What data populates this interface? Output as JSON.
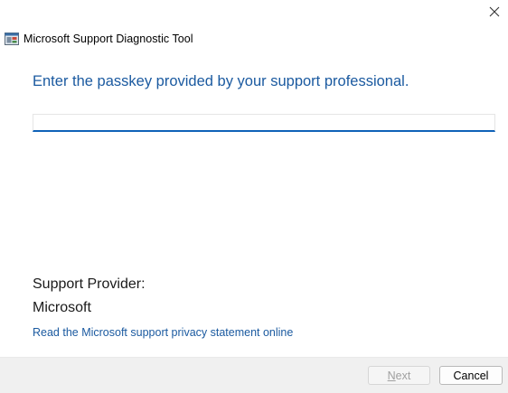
{
  "window": {
    "title": "Microsoft Support Diagnostic Tool",
    "close_icon": "close-icon",
    "app_icon": "diagnostic-tool-icon"
  },
  "main": {
    "heading": "Enter the passkey provided by your support professional.",
    "passkey_input": {
      "value": "",
      "placeholder": ""
    },
    "provider_label": "Support Provider:",
    "provider_value": "Microsoft",
    "privacy_link": "Read the Microsoft support privacy statement online"
  },
  "footer": {
    "next_label_first": "N",
    "next_label_rest": "ext",
    "next_enabled": false,
    "cancel_label": "Cancel"
  },
  "colors": {
    "accent": "#1b5aa0",
    "input_underline": "#0f62b8",
    "footer_bg": "#f0f0f0"
  }
}
